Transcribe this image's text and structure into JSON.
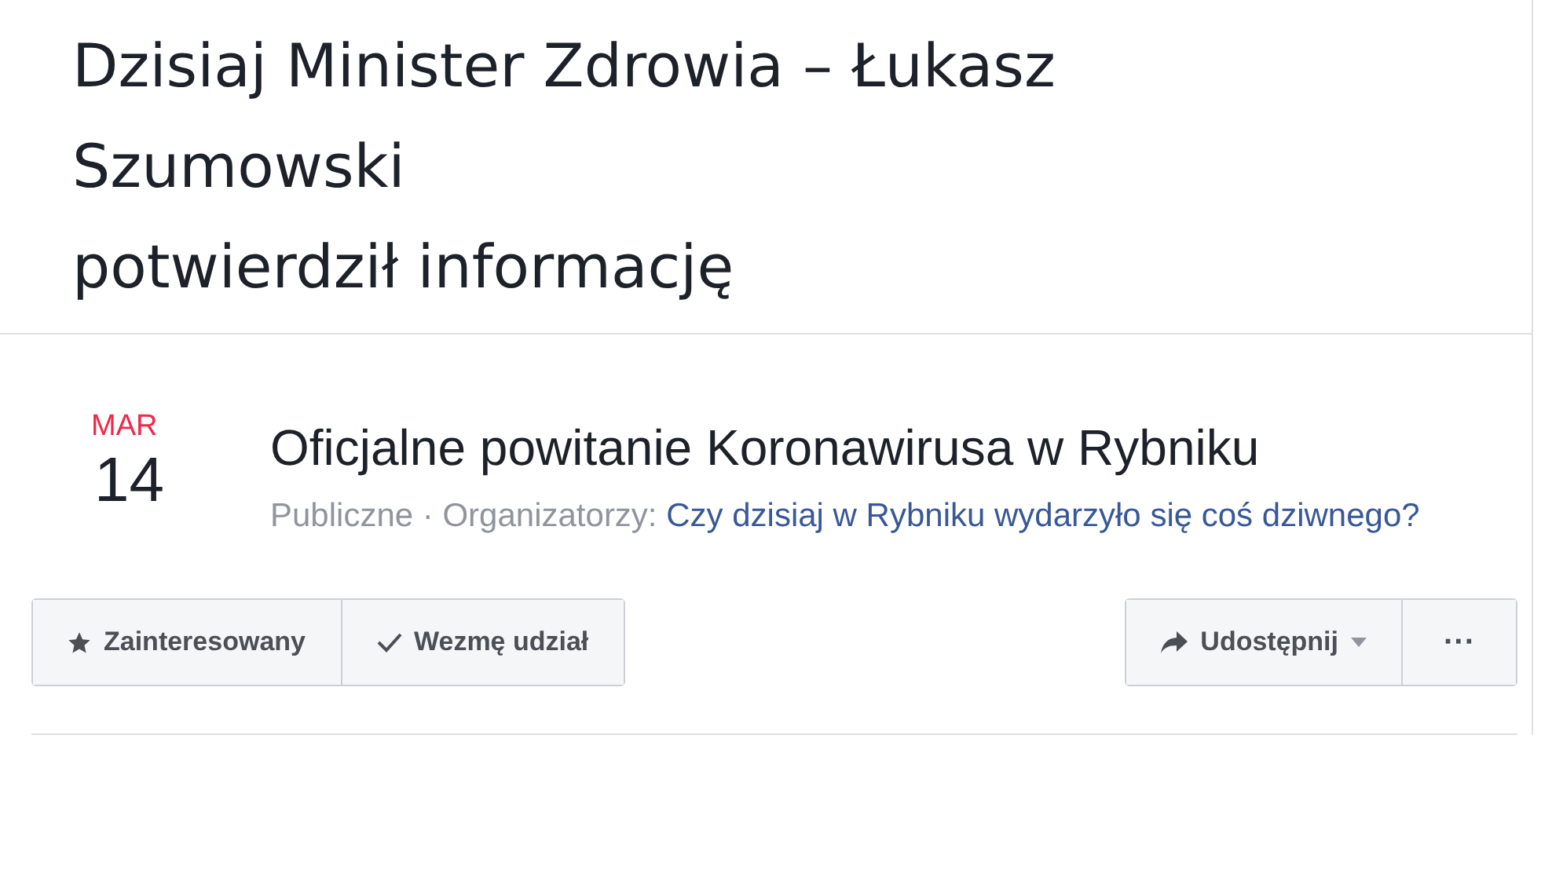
{
  "cover": {
    "lines": [
      "Dzisiaj Minister Zdrowia – Łukasz",
      "Szumowski",
      "potwierdził informację"
    ]
  },
  "event": {
    "month": "MAR",
    "day": "14",
    "title": "Oficjalne powitanie Koronawirusa w Rybniku",
    "privacy": "Publiczne · Organizatorzy: ",
    "organizer": "Czy dzisiaj w Rybniku wydarzyło się coś dziwnego?"
  },
  "actions": [
    {
      "kind": "interested",
      "label": "Zainteresowany"
    },
    {
      "kind": "going",
      "label": "Wezmę udział"
    }
  ],
  "share": {
    "label": "Udostępnij"
  },
  "more": {
    "label": "···"
  }
}
